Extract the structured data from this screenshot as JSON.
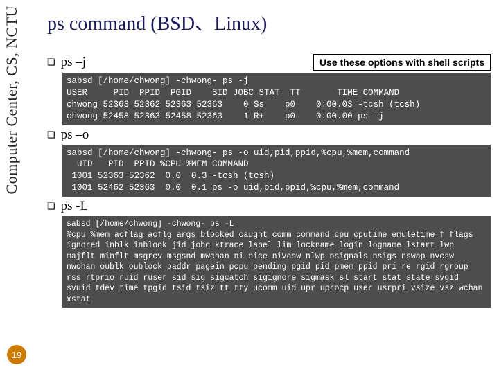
{
  "sidebar": "Computer Center, CS, NCTU",
  "page_number": "19",
  "title": "ps command (BSD、Linux)",
  "note": "Use these options with shell scripts",
  "sections": {
    "s1": {
      "label": "ps –j"
    },
    "s2": {
      "label": "ps –o"
    },
    "s3": {
      "label": "ps -L"
    }
  },
  "term1": "sabsd [/home/chwong] -chwong- ps -j\nUSER     PID  PPID  PGID    SID JOBC STAT  TT       TIME COMMAND\nchwong 52363 52362 52363 52363    0 Ss    p0    0:00.03 -tcsh (tcsh)\nchwong 52458 52363 52458 52363    1 R+    p0    0:00.00 ps -j",
  "term2": "sabsd [/home/chwong] -chwong- ps -o uid,pid,ppid,%cpu,%mem,command\n  UID   PID  PPID %CPU %MEM COMMAND\n 1001 52363 52362  0.0  0.3 -tcsh (tcsh)\n 1001 52462 52363  0.0  0.1 ps -o uid,pid,ppid,%cpu,%mem,command",
  "term3": "sabsd [/home/chwong] -chwong- ps -L\n%cpu %mem acflag acflg args blocked caught comm command cpu cputime emuletime f flags ignored inblk inblock jid jobc ktrace label lim lockname login logname lstart lwp majflt minflt msgrcv msgsnd mwchan ni nice nivcsw nlwp nsignals nsigs nswap nvcsw nwchan oublk oublock paddr pagein pcpu pending pgid pid pmem ppid pri re rgid rgroup rss rtprio ruid ruser sid sig sigcatch sigignore sigmask sl start stat state svgid svuid tdev time tpgid tsid tsiz tt tty ucomm uid upr uprocp user usrpri vsize vsz wchan xstat"
}
